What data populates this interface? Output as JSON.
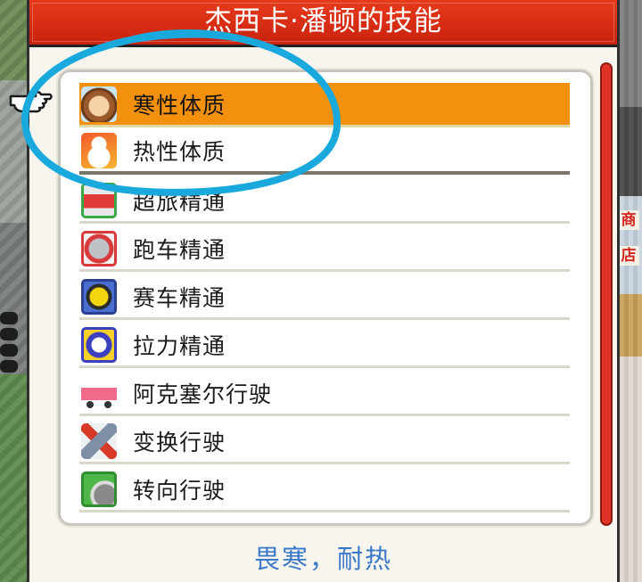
{
  "window": {
    "title": "杰西卡·潘顿的技能",
    "description": "畏寒，耐热"
  },
  "skills": [
    {
      "label": "寒性体质",
      "icon": "hamster-icon",
      "selected": true
    },
    {
      "label": "热性体质",
      "icon": "snowman-icon",
      "selected": false
    },
    {
      "label": "超旅精通",
      "icon": "tour-car-icon",
      "selected": false
    },
    {
      "label": "跑车精通",
      "icon": "sports-car-icon",
      "selected": false
    },
    {
      "label": "赛车精通",
      "icon": "race-car-icon",
      "selected": false
    },
    {
      "label": "拉力精通",
      "icon": "rally-car-icon",
      "selected": false
    },
    {
      "label": "阿克塞尔行驶",
      "icon": "axel-car-icon",
      "selected": false
    },
    {
      "label": "变换行驶",
      "icon": "shift-tool-icon",
      "selected": false
    },
    {
      "label": "转向行驶",
      "icon": "steering-road-icon",
      "selected": false
    }
  ],
  "colors": {
    "title_bar": "#d92f15",
    "selected_row": "#f4910c",
    "description_text": "#3a78c9",
    "annotation_circle": "#1aa9dd",
    "scrollbar": "#e03328"
  },
  "background": {
    "right_signs": [
      "商",
      "店"
    ]
  }
}
